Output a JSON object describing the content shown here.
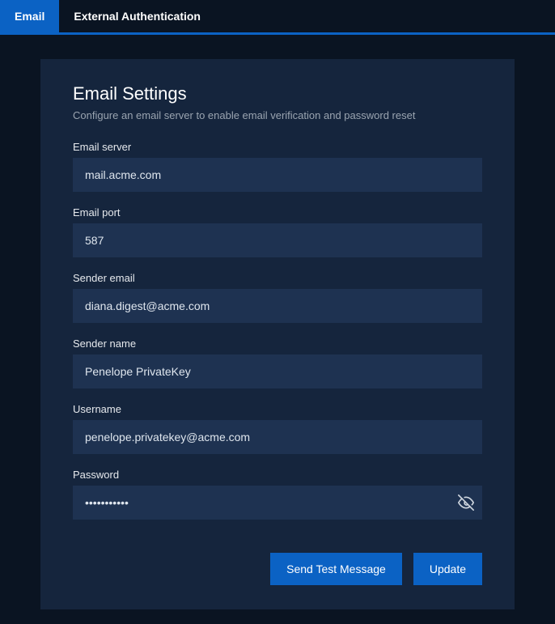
{
  "tabs": {
    "email": "Email",
    "external_auth": "External Authentication"
  },
  "page": {
    "title": "Email Settings",
    "subtitle": "Configure an email server to enable email verification and password reset"
  },
  "fields": {
    "email_server": {
      "label": "Email server",
      "value": "mail.acme.com"
    },
    "email_port": {
      "label": "Email port",
      "value": "587"
    },
    "sender_email": {
      "label": "Sender email",
      "value": "diana.digest@acme.com"
    },
    "sender_name": {
      "label": "Sender name",
      "value": "Penelope PrivateKey"
    },
    "username": {
      "label": "Username",
      "value": "penelope.privatekey@acme.com"
    },
    "password": {
      "label": "Password",
      "value": "•••••••••••"
    }
  },
  "actions": {
    "send_test": "Send Test Message",
    "update": "Update"
  }
}
